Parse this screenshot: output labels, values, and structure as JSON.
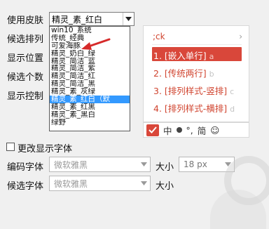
{
  "labels": {
    "skin": "使用皮肤",
    "candidate_order": "候选排列",
    "display_position": "显示位置",
    "candidate_count": "候选个数",
    "display_control": "显示控制"
  },
  "skin_combo": {
    "value": "精灵_素_红白"
  },
  "skin_list": {
    "items": [
      "win10_系统",
      "传统_经典",
      "可爱海豚",
      "精灵_奶白_绿",
      "精灵_简洁_蓝",
      "精灵_简洁_紫",
      "精灵_简洁_红",
      "精灵_简洁_黑",
      "精灵_素_灰绿",
      "精灵_素_红白（默",
      "精灵_素_红黑",
      "精灵_素_黑白",
      "绿野"
    ],
    "selected_index": 9
  },
  "preview": {
    "input": ";ck",
    "chevron": "›",
    "candidates": [
      {
        "num": "1.",
        "text": "[嵌入单行]",
        "key": "a"
      },
      {
        "num": "2.",
        "text": "[传统两行]",
        "key": "b"
      },
      {
        "num": "3.",
        "text": "[排列样式-竖排]",
        "key": "c"
      },
      {
        "num": "4.",
        "text": "[排列样式-横排]",
        "key": "d"
      }
    ],
    "status": {
      "lang": "中",
      "punct": "°,",
      "mode": "简",
      "emoji": "☺"
    }
  },
  "font": {
    "change_label": "更改显示字体",
    "code_font_label": "编码字体",
    "code_font_value": "微软雅黑",
    "size_label": "大小",
    "size_value": "18 px",
    "cand_font_label": "候选字体",
    "cand_font_value": "微软雅黑",
    "size2_label": "大小"
  },
  "colors": {
    "accent": "#d9473a",
    "selection": "#3399ff"
  }
}
